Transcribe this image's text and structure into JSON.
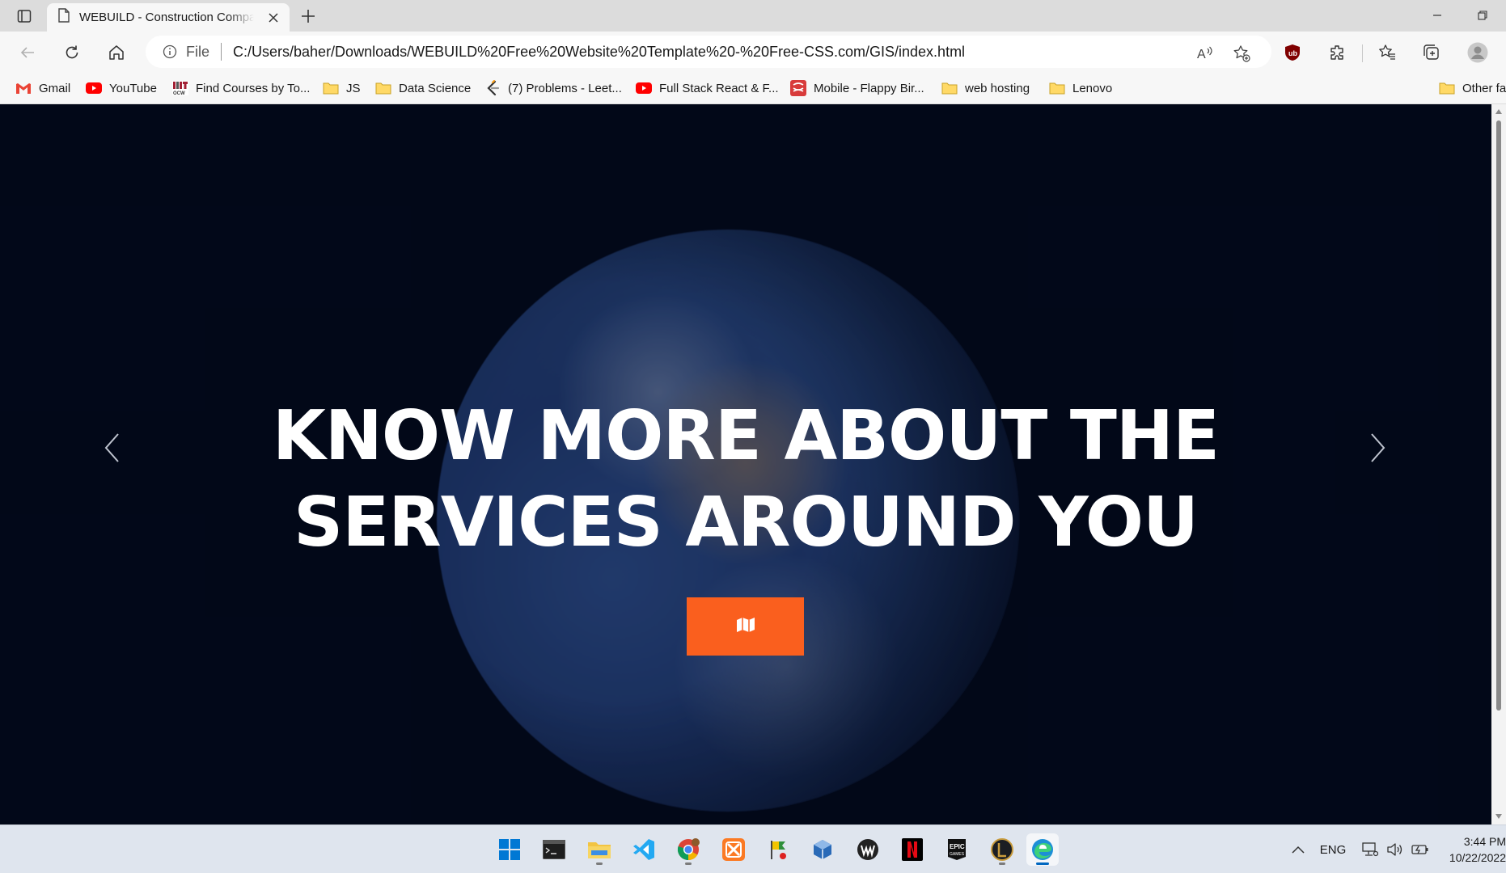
{
  "browser": {
    "tab": {
      "title": "WEBUILD - Construction Company"
    },
    "address": {
      "scheme_label": "File",
      "url": "C:/Users/baher/Downloads/WEBUILD%20Free%20Website%20Template%20-%20Free-CSS.com/GIS/index.html"
    },
    "bookmarks": [
      {
        "label": "Gmail",
        "icon": "gmail-icon"
      },
      {
        "label": "YouTube",
        "icon": "youtube-icon"
      },
      {
        "label": "Find Courses by To...",
        "icon": "mit-ocw-icon"
      },
      {
        "label": "JS",
        "icon": "folder-icon"
      },
      {
        "label": "Data Science",
        "icon": "folder-icon"
      },
      {
        "label": "(7) Problems - Leet...",
        "icon": "leetcode-icon"
      },
      {
        "label": "Full Stack React & F...",
        "icon": "youtube-icon"
      },
      {
        "label": "Mobile - Flappy Bir...",
        "icon": "app-icon"
      },
      {
        "label": "web hosting",
        "icon": "folder-icon"
      },
      {
        "label": "Lenovo",
        "icon": "folder-icon"
      }
    ],
    "other_favorites": "Other fa"
  },
  "page": {
    "hero": {
      "line1": "KNOW MORE ABOUT THE",
      "line2": "SERVICES AROUND YOU",
      "button_icon": "map-icon"
    },
    "colors": {
      "accent": "#fa5f1e",
      "background": "#030a1e"
    }
  },
  "taskbar": {
    "language": "ENG",
    "time": "3:44 PM",
    "date": "10/22/2022"
  }
}
